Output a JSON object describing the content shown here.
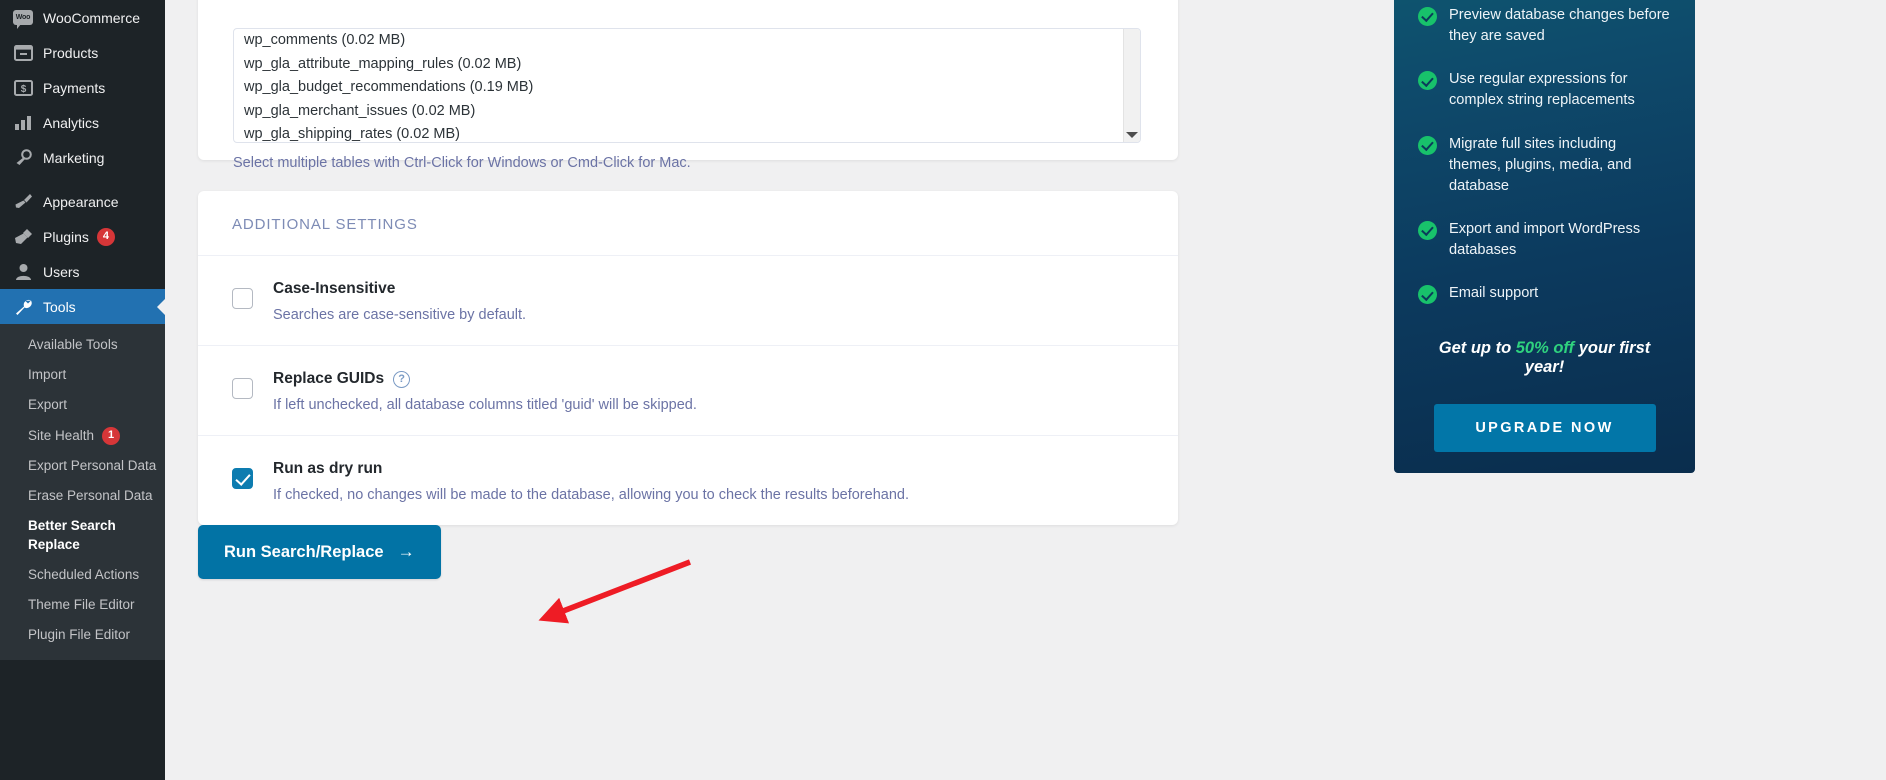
{
  "sidebar": {
    "menu": [
      {
        "label": "WooCommerce",
        "icon": "woocommerce-icon",
        "badge": null,
        "current": false
      },
      {
        "label": "Products",
        "icon": "products-icon",
        "badge": null,
        "current": false
      },
      {
        "label": "Payments",
        "icon": "payments-icon",
        "badge": null,
        "current": false
      },
      {
        "label": "Analytics",
        "icon": "analytics-icon",
        "badge": null,
        "current": false
      },
      {
        "label": "Marketing",
        "icon": "marketing-megaphone-icon",
        "badge": null,
        "current": false
      },
      {
        "label": "Appearance",
        "icon": "appearance-brush-icon",
        "badge": null,
        "current": false
      },
      {
        "label": "Plugins",
        "icon": "plugins-plug-icon",
        "badge": "4",
        "current": false
      },
      {
        "label": "Users",
        "icon": "users-icon",
        "badge": null,
        "current": false
      },
      {
        "label": "Tools",
        "icon": "tools-wrench-icon",
        "badge": null,
        "current": true
      }
    ],
    "submenu": [
      {
        "label": "Available Tools",
        "badge": null,
        "active": false
      },
      {
        "label": "Import",
        "badge": null,
        "active": false
      },
      {
        "label": "Export",
        "badge": null,
        "active": false
      },
      {
        "label": "Site Health",
        "badge": "1",
        "active": false
      },
      {
        "label": "Export Personal Data",
        "badge": null,
        "active": false
      },
      {
        "label": "Erase Personal Data",
        "badge": null,
        "active": false
      },
      {
        "label": "Better Search Replace",
        "badge": null,
        "active": true
      },
      {
        "label": "Scheduled Actions",
        "badge": null,
        "active": false
      },
      {
        "label": "Theme File Editor",
        "badge": null,
        "active": false
      },
      {
        "label": "Plugin File Editor",
        "badge": null,
        "active": false
      }
    ]
  },
  "tables": {
    "items": [
      "wp_comments (0.02 MB)",
      "wp_gla_attribute_mapping_rules (0.02 MB)",
      "wp_gla_budget_recommendations (0.19 MB)",
      "wp_gla_merchant_issues (0.02 MB)",
      "wp_gla_shipping_rates (0.02 MB)"
    ],
    "hint": "Select multiple tables with Ctrl-Click for Windows or Cmd-Click for Mac.",
    "scroll_down_icon": "chevron-down-icon"
  },
  "additional_settings": {
    "header": "ADDITIONAL SETTINGS",
    "rows": [
      {
        "title": "Case-Insensitive",
        "description": "Searches are case-sensitive by default.",
        "checked": false,
        "help": null
      },
      {
        "title": "Replace GUIDs",
        "description": "If left unchecked, all database columns titled 'guid' will be skipped.",
        "checked": false,
        "help": "?"
      },
      {
        "title": "Run as dry run",
        "description": "If checked, no changes will be made to the database, allowing you to check the results beforehand.",
        "checked": true,
        "help": null
      }
    ]
  },
  "actions": {
    "run_button_label": "Run Search/Replace",
    "run_button_arrow": "→",
    "run_button_arrow_icon": "arrow-right-icon"
  },
  "promo": {
    "features": [
      "Preview database changes before they are saved",
      "Use regular expressions for complex string replacements",
      "Migrate full sites including themes, plugins, media, and database",
      "Export and import WordPress databases",
      "Email support"
    ],
    "offer_prefix": "Get up to ",
    "offer_percent": "50% off",
    "offer_suffix": " your first year!",
    "upgrade_label": "UPGRADE NOW"
  },
  "colors": {
    "sidebar_bg": "#1d2327",
    "sidebar_submenu_bg": "#2c3338",
    "wp_blue": "#2271b1",
    "badge_red": "#d63638",
    "action_blue": "#0273a5",
    "muted_text": "#6b73a5",
    "promo_check_green": "#18c26b",
    "promo_offer_green": "#2fd27e",
    "annotation_red": "#ee1c25"
  }
}
